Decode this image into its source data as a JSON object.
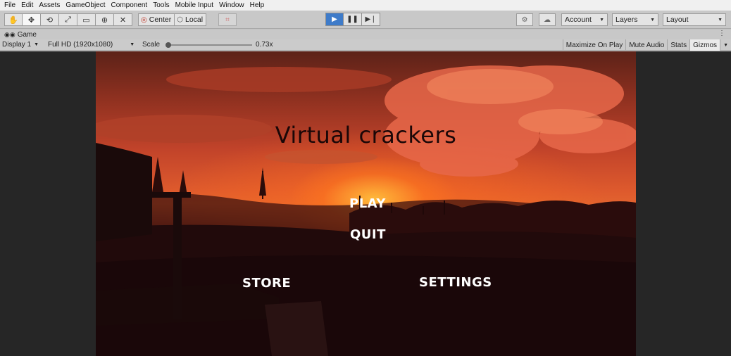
{
  "menu": [
    "File",
    "Edit",
    "Assets",
    "GameObject",
    "Component",
    "Tools",
    "Mobile Input",
    "Window",
    "Help"
  ],
  "toolbar": {
    "tools": [
      {
        "name": "hand-tool-icon",
        "glyph": "✋"
      },
      {
        "name": "move-tool-icon",
        "glyph": "✥"
      },
      {
        "name": "rotate-tool-icon",
        "glyph": "⟲"
      },
      {
        "name": "scale-tool-icon",
        "glyph": "⤢"
      },
      {
        "name": "rect-tool-icon",
        "glyph": "▭"
      },
      {
        "name": "transform-tool-icon",
        "glyph": "⊕"
      },
      {
        "name": "custom-tool-icon",
        "glyph": "✕"
      }
    ],
    "pivot_label": "Center",
    "pivot_rotation_label": "Local",
    "account_label": "Account",
    "layers_label": "Layers",
    "layout_label": "Layout"
  },
  "game_tab": {
    "label": "Game"
  },
  "game_bar": {
    "display": "Display 1",
    "resolution": "Full HD (1920x1080)",
    "scale_label": "Scale",
    "scale_value": "0.73x",
    "maximize": "Maximize On Play",
    "mute": "Mute Audio",
    "stats": "Stats",
    "gizmos": "Gizmos"
  },
  "game": {
    "title": "Virtual crackers",
    "play": "PLAY",
    "quit": "QUIT",
    "store": "STORE",
    "settings": "SETTINGS"
  }
}
